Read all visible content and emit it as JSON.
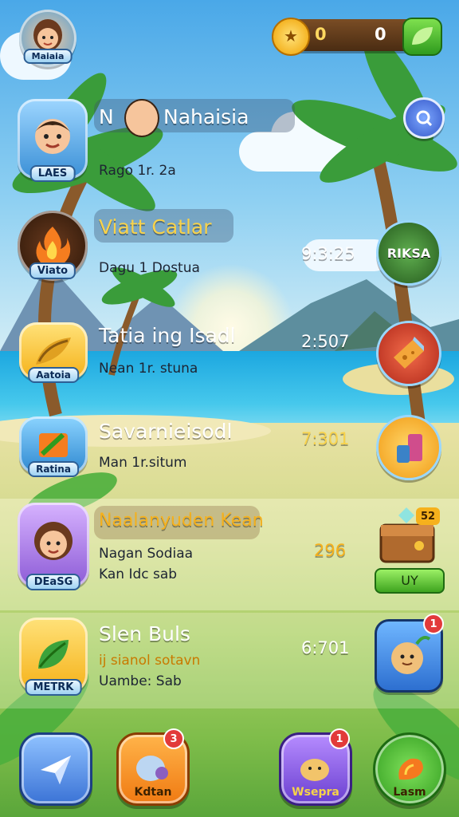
{
  "currency": {
    "coins": "0",
    "gems": "0"
  },
  "profile": {
    "label": "Maiaia"
  },
  "rows": [
    {
      "name": "Nahaisia",
      "badge": "LAES",
      "detail": "Rago 1r. 2a",
      "time": ""
    },
    {
      "name": "Viatt Catlar",
      "badge": "Viato",
      "detail": "Dagu 1 Dostua",
      "time": "9:3:25",
      "side": "RIKSA"
    },
    {
      "name": "Tatia ing Isadl",
      "badge": "Aatoia",
      "detail": "Nean 1r. stuna",
      "time": "2:507"
    },
    {
      "name": "Savarnieisodl",
      "badge": "Ratina",
      "detail": "Man 1r.situm",
      "time": "7:301"
    },
    {
      "name": "Naalanyuden Kean",
      "badge": "DEaSG",
      "detail": "Nagan Sodiaa",
      "detail2": "Kan Idc sab",
      "time": "296",
      "side": "UY",
      "side_badge": "52"
    },
    {
      "name": "Slen Buls",
      "badge": "METRK",
      "detail": "ij sianol sotavn",
      "detail2": "Uambe: Sab",
      "time": "6:701",
      "side_badge": "1"
    }
  ],
  "bottom_nav": [
    {
      "label": ""
    },
    {
      "label": "Kdtan",
      "badge": "3"
    },
    {
      "label": "Wsepra",
      "badge": "1"
    },
    {
      "label": "Lasm"
    }
  ],
  "colors": {
    "accent": "#f6b11c",
    "sky": "#7cc3ee",
    "sea": "#2ab6e6"
  }
}
